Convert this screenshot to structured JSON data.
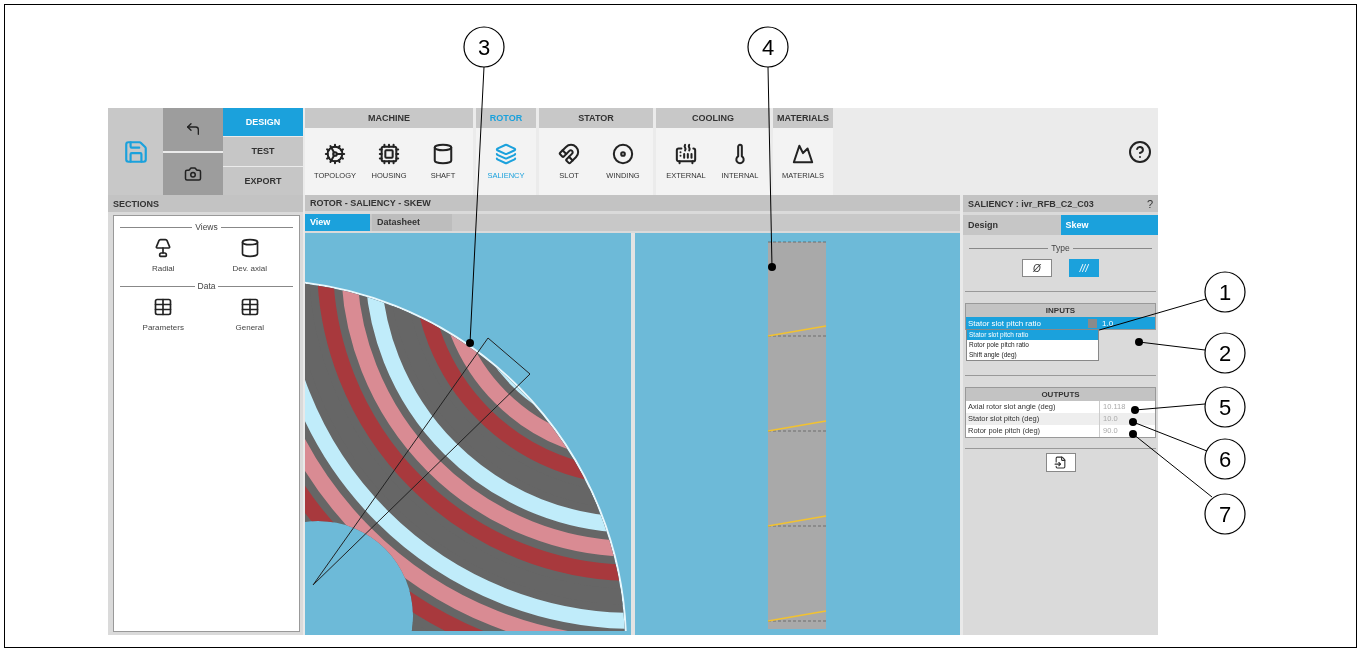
{
  "toolbar": {
    "modes": [
      {
        "label": "DESIGN",
        "selected": true
      },
      {
        "label": "TEST",
        "selected": false
      },
      {
        "label": "EXPORT",
        "selected": false
      }
    ],
    "groups": [
      {
        "title": "MACHINE",
        "selected": false,
        "items": [
          {
            "label": "TOPOLOGY",
            "selected": false
          },
          {
            "label": "HOUSING",
            "selected": false
          },
          {
            "label": "SHAFT",
            "selected": false
          }
        ]
      },
      {
        "title": "ROTOR",
        "selected": true,
        "items": [
          {
            "label": "SALIENCY",
            "selected": true
          }
        ]
      },
      {
        "title": "STATOR",
        "selected": false,
        "items": [
          {
            "label": "SLOT",
            "selected": false
          },
          {
            "label": "WINDING",
            "selected": false
          }
        ]
      },
      {
        "title": "COOLING",
        "selected": false,
        "items": [
          {
            "label": "EXTERNAL",
            "selected": false
          },
          {
            "label": "INTERNAL",
            "selected": false
          }
        ]
      },
      {
        "title": "MATERIALS",
        "selected": false,
        "items": [
          {
            "label": "MATERIALS",
            "selected": false
          }
        ]
      }
    ]
  },
  "sections": {
    "title": "SECTIONS",
    "groups": [
      {
        "title": "Views",
        "items": [
          {
            "label": "Radial"
          },
          {
            "label": "Dev. axial"
          }
        ]
      },
      {
        "title": "Data",
        "items": [
          {
            "label": "Parameters"
          },
          {
            "label": "General"
          }
        ]
      }
    ]
  },
  "view": {
    "title": "ROTOR - SALIENCY - SKEW",
    "tabs": [
      {
        "label": "View",
        "selected": true
      },
      {
        "label": "Datasheet",
        "selected": false
      }
    ]
  },
  "saliency": {
    "title": "SALIENCY : ivr_RFB_C2_C03",
    "help": "?",
    "tabs": [
      {
        "label": "Design",
        "selected": false
      },
      {
        "label": "Skew",
        "selected": true
      }
    ],
    "type": {
      "label": "Type",
      "options": [
        {
          "symbol": "Ø",
          "selected": false
        },
        {
          "symbol": "///",
          "selected": true
        }
      ]
    },
    "inputs": {
      "title": "INPUTS",
      "dropdown": {
        "value": "Stator slot pitch ratio",
        "expanded": true,
        "options": [
          {
            "label": "Stator slot pitch ratio",
            "selected": true
          },
          {
            "label": "Rotor pole pitch ratio",
            "selected": false
          },
          {
            "label": "Shift angle (deg)",
            "selected": false
          }
        ]
      },
      "value": "1.0"
    },
    "outputs": {
      "title": "OUTPUTS",
      "rows": [
        {
          "label": "Axial rotor slot angle (deg)",
          "value": "10.118"
        },
        {
          "label": "Stator slot pitch (deg)",
          "value": "10.0"
        },
        {
          "label": "Rotor pole pitch (deg)",
          "value": "90.0"
        }
      ]
    }
  },
  "callouts": [
    {
      "number": "3"
    },
    {
      "number": "4"
    },
    {
      "number": "1"
    },
    {
      "number": "2"
    },
    {
      "number": "5"
    },
    {
      "number": "6"
    },
    {
      "number": "7"
    }
  ]
}
